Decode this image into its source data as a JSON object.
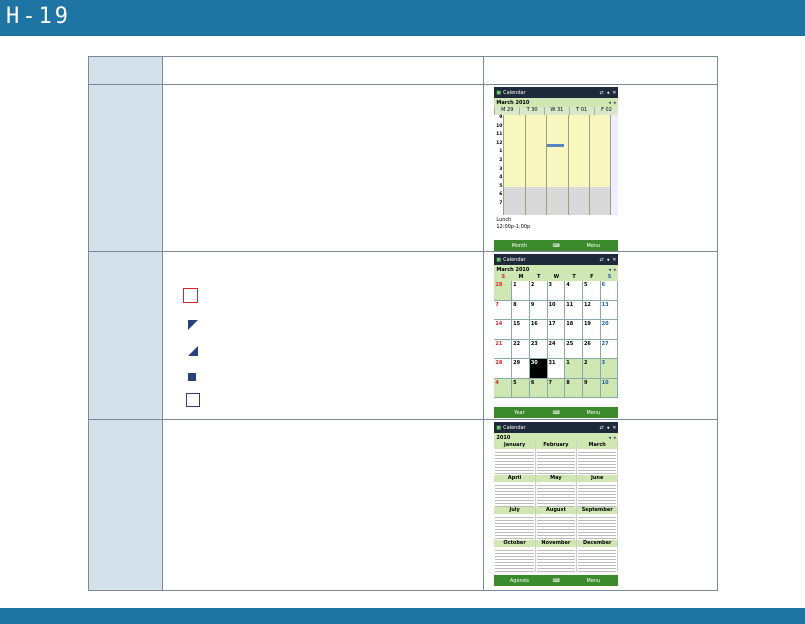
{
  "header": {
    "brand": "H-19"
  },
  "week_view": {
    "app": "Calendar",
    "month_label": "March  2010",
    "days": [
      "M 29",
      "T 30",
      "W 31",
      "T 01",
      "F 02"
    ],
    "hours": [
      "9",
      "10",
      "11",
      "12",
      "1",
      "2",
      "3",
      "4",
      "5",
      "6",
      "7"
    ],
    "appointment_title": "Lunch",
    "appointment_time": "12:00p-1:00p",
    "soft_left": "Month",
    "soft_right": "Menu"
  },
  "month_view": {
    "app": "Calendar",
    "month_label": "March  2010",
    "weekdays": [
      "S",
      "M",
      "T",
      "W",
      "T",
      "F",
      "S"
    ],
    "dates": [
      "28",
      "1",
      "2",
      "3",
      "4",
      "5",
      "6",
      "7",
      "8",
      "9",
      "10",
      "11",
      "12",
      "13",
      "14",
      "15",
      "16",
      "17",
      "18",
      "19",
      "20",
      "21",
      "22",
      "23",
      "24",
      "25",
      "26",
      "27",
      "28",
      "29",
      "30",
      "31",
      "1",
      "2",
      "3",
      "4",
      "5",
      "6",
      "7",
      "8",
      "9",
      "10"
    ],
    "soft_left": "Year",
    "soft_right": "Menu"
  },
  "year_view": {
    "app": "Calendar",
    "year_label": "2010",
    "months": [
      "January",
      "February",
      "March",
      "April",
      "May",
      "June",
      "July",
      "August",
      "September",
      "October",
      "November",
      "December"
    ],
    "soft_left": "Agenda",
    "soft_right": "Menu"
  },
  "colors": {
    "bar": "#1e75a3",
    "label_cell": "#d4e1ea",
    "legend_red": "#d4242c",
    "legend_blue": "#28417a"
  }
}
